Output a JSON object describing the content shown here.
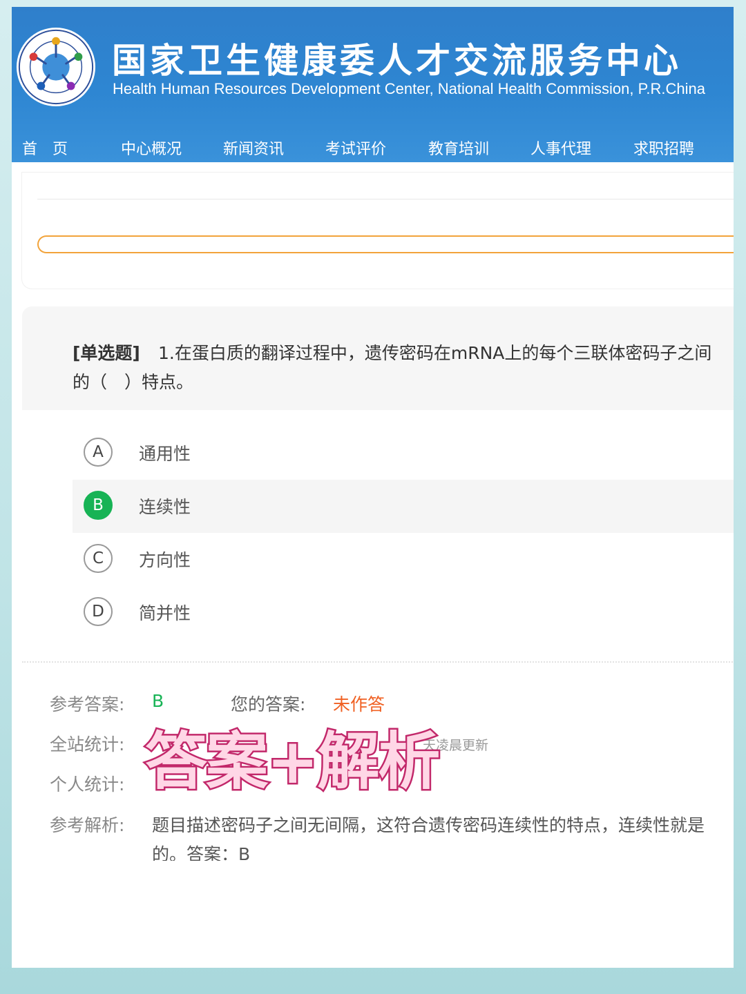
{
  "header": {
    "title": "国家卫生健康委人才交流服务中心",
    "subtitle": "Health Human Resources Development Center, National Health Commission, P.R.China",
    "logo_icon": "health-center-emblem-icon",
    "colors": {
      "header_bg": "#2e86d2"
    }
  },
  "nav": {
    "items": [
      {
        "label": "首　页"
      },
      {
        "label": "中心概况"
      },
      {
        "label": "新闻资讯"
      },
      {
        "label": "考试评价"
      },
      {
        "label": "教育培训"
      },
      {
        "label": "人事代理"
      },
      {
        "label": "求职招聘"
      }
    ]
  },
  "question": {
    "type": "[单选题]",
    "text_line1": "1.在蛋白质的翻译过程中，遗传密码在mRNA上的每个三联体密码子之间",
    "text_line2": "的（　）特点。",
    "options": [
      {
        "letter": "A",
        "text": "通用性"
      },
      {
        "letter": "B",
        "text": "连续性"
      },
      {
        "letter": "C",
        "text": "方向性"
      },
      {
        "letter": "D",
        "text": "简并性"
      }
    ],
    "selected": "B",
    "colors": {
      "correct": "#17b355",
      "unanswered": "#f06022"
    }
  },
  "result": {
    "ref_answer_label": "参考答案:",
    "ref_answer_value": "B",
    "your_answer_label": "您的答案:",
    "your_answer_value": "未作答",
    "site_stats_label": "全站统计:",
    "site_stats_note": "天凌晨更新",
    "personal_stats_label": "个人统计:",
    "analysis_label": "参考解析:",
    "analysis_line1": "题目描述密码子之间无间隔，这符合遗传密码连续性的特点，连续性就是",
    "analysis_line2": "的。答案：B"
  },
  "overlay": {
    "text": "答案+解析"
  }
}
